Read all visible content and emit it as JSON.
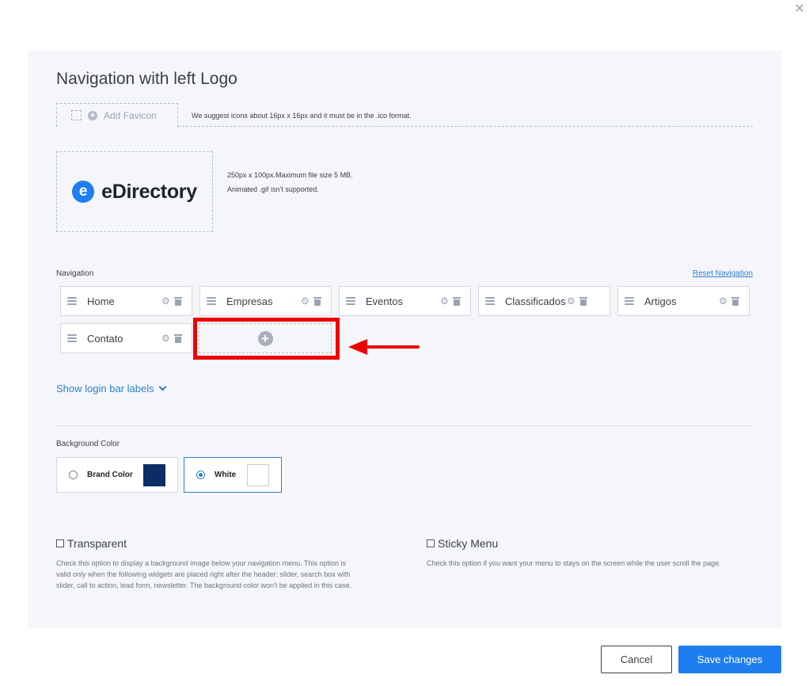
{
  "dialog": {
    "close_icon": "close-icon",
    "title": "Navigation with left Logo"
  },
  "favicon": {
    "button_label": "Add Favicon",
    "hint": "We suggest icons about 16px x 16px and it must be in the .ico format."
  },
  "logo": {
    "mark_letter": "e",
    "brand_name": "eDirectory",
    "hint_line1": "250px x 100px.Maximum file size 5 MB.",
    "hint_line2": "Animated .gif isn't supported."
  },
  "navigation": {
    "label": "Navigation",
    "reset_label": "Reset Navigation",
    "items": [
      {
        "label": "Home"
      },
      {
        "label": "Empresas"
      },
      {
        "label": "Eventos"
      },
      {
        "label": "Classificados"
      },
      {
        "label": "Artigos"
      },
      {
        "label": "Contato"
      }
    ],
    "add_item_icon": "plus-circle-icon",
    "highlight_color": "#ee0000"
  },
  "login_bar": {
    "toggle_label": "Show login bar labels"
  },
  "background_color": {
    "label": "Background Color",
    "options": [
      {
        "label": "Brand Color",
        "swatch": "#0b2c66",
        "selected": false
      },
      {
        "label": "White",
        "swatch": "#ffffff",
        "selected": true
      }
    ]
  },
  "options": {
    "transparent": {
      "label": "Transparent",
      "checked": false,
      "description_lines": [
        "Check this option to display a background image below your navigation menu. This option is",
        "valid only when the following widgets are placed right after the header: slider, search box with",
        "slider, call to action, lead form, newsletter. The background color won't be applied in this case."
      ]
    },
    "sticky": {
      "label": "Sticky Menu",
      "checked": false,
      "description": "Check this option if you want your menu to stays on the screen while the user scroll the page."
    }
  },
  "footer": {
    "cancel_label": "Cancel",
    "save_label": "Save changes"
  },
  "colors": {
    "accent": "#1e7ef0",
    "link": "#2d7fd4",
    "panel_bg": "#f4f6f9"
  }
}
